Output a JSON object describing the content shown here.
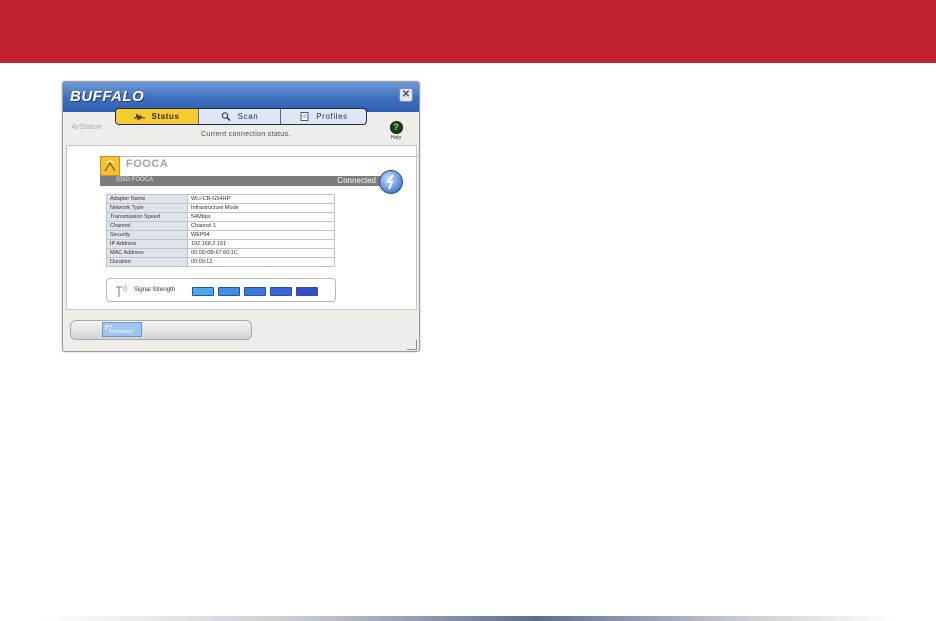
{
  "app": {
    "logo_text": "BUFFALO",
    "close_symbol": "✕",
    "airstation_label": "AirStation",
    "status_message": "Current connection status.",
    "help": {
      "symbol": "?",
      "label": "Help"
    },
    "tabs": [
      {
        "label": "Status",
        "icon": "signal-wave-icon",
        "active": true
      },
      {
        "label": "Scan",
        "icon": "magnifier-icon",
        "active": false
      },
      {
        "label": "Profiles",
        "icon": "document-icon",
        "active": false
      }
    ]
  },
  "connection": {
    "network_name": "FOOCA",
    "ssid_text": "SSID:FOOCA",
    "state": "Connected"
  },
  "details": [
    {
      "key": "Adapter Name",
      "value": "WLI-CB-G54HP"
    },
    {
      "key": "Network Type",
      "value": "Infrastructure Mode"
    },
    {
      "key": "Transmission Speed",
      "value": "54Mbps"
    },
    {
      "key": "Channel",
      "value": "Channel 1"
    },
    {
      "key": "Security",
      "value": "WEP64"
    },
    {
      "key": "IP Address",
      "value": "192.168.2.151"
    },
    {
      "key": "MAC Address",
      "value": "00:0D:0B:67:60:1C"
    },
    {
      "key": "Duration",
      "value": "00:00:12"
    }
  ],
  "signal": {
    "label": "Signal Strength",
    "bars_lit": 5,
    "bars_total": 5,
    "bar_colors": [
      "#48a9ee",
      "#3f8de6",
      "#3a78df",
      "#3864d6",
      "#3650cc"
    ]
  },
  "footer": {
    "reconnect_label": "Reconnect"
  },
  "colors": {
    "brand_red": "#c1202d",
    "titlebar_blue": "#3d6fbe",
    "active_tab": "#f6cc34"
  }
}
